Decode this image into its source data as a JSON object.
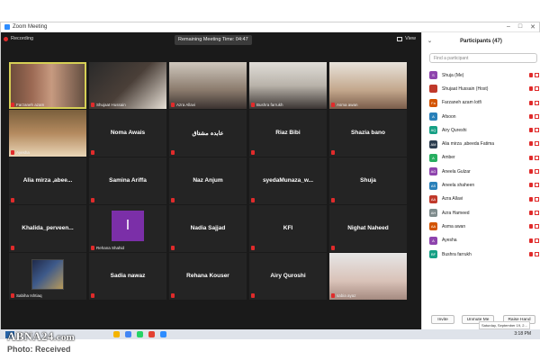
{
  "window": {
    "title": "Zoom Meeting",
    "controls": [
      "–",
      "□",
      "✕"
    ]
  },
  "meeting": {
    "recording_label": "Recording",
    "timer_text": "Remaining Meeting Time: 04:47",
    "view_label": "View"
  },
  "tiles": [
    {
      "name": "Farzaneh azam",
      "show_name_center": false,
      "label": "Farzaneh azam",
      "style": "vid1",
      "active": true
    },
    {
      "name": "Shujaat Hussain",
      "show_name_center": false,
      "label": "Shujaat Hussain",
      "style": "vid2"
    },
    {
      "name": "Azra Allavi",
      "show_name_center": false,
      "label": "Azra Allavi",
      "style": "vid3"
    },
    {
      "name": "Bushra farrukh",
      "show_name_center": false,
      "label": "Bushra farrukh",
      "style": "vid4"
    },
    {
      "name": "Asma awan",
      "show_name_center": false,
      "label": "Asma awan",
      "style": "vid5"
    },
    {
      "name": "Ayesha",
      "show_name_center": false,
      "label": "Ayesha",
      "style": "vid6"
    },
    {
      "name": "Noma Awais",
      "show_name_center": true,
      "label": ""
    },
    {
      "name": "عابدہ مشتاق",
      "show_name_center": true,
      "label": ""
    },
    {
      "name": "Riaz Bibi",
      "show_name_center": true,
      "label": ""
    },
    {
      "name": "Shazia bano",
      "show_name_center": true,
      "label": ""
    },
    {
      "name": "Alia mirza ,abee...",
      "show_name_center": true,
      "label": ""
    },
    {
      "name": "Samina Ariffa",
      "show_name_center": true,
      "label": ""
    },
    {
      "name": "Naz Anjum",
      "show_name_center": true,
      "label": ""
    },
    {
      "name": "syedaMunaza_w...",
      "show_name_center": true,
      "label": ""
    },
    {
      "name": "Shuja",
      "show_name_center": true,
      "label": ""
    },
    {
      "name": "Khalida_perveen...",
      "show_name_center": true,
      "label": ""
    },
    {
      "name": "Rehana Shahid",
      "show_name_center": false,
      "label": "Rehana Shahid",
      "style": "purple",
      "initial": "I"
    },
    {
      "name": "Nadia Sajjad",
      "show_name_center": true,
      "label": ""
    },
    {
      "name": "KFI",
      "show_name_center": true,
      "label": ""
    },
    {
      "name": "Nighat Naheed",
      "show_name_center": true,
      "label": ""
    },
    {
      "name": "Sabiha Ishtiaq",
      "show_name_center": false,
      "label": "Sabiha Ishtiaq",
      "style": "thumb"
    },
    {
      "name": "Sadia nawaz",
      "show_name_center": true,
      "label": ""
    },
    {
      "name": "Rehana Kouser",
      "show_name_center": true,
      "label": ""
    },
    {
      "name": "Airy Quroshi",
      "show_name_center": true,
      "label": ""
    },
    {
      "name": "sabia ayaz",
      "show_name_center": false,
      "label": "sabia ayaz",
      "style": "vid7"
    }
  ],
  "participants_panel": {
    "title": "Participants (47)",
    "search_placeholder": "Find a participant",
    "list": [
      {
        "initials": "S",
        "name": "Shuja (Me)",
        "color": "#8e44ad"
      },
      {
        "initials": "",
        "name": "Shujaat Hussain (Host)",
        "color": "#c0392b"
      },
      {
        "initials": "Fa",
        "name": "Farzaneh azam lotfi",
        "color": "#d35400"
      },
      {
        "initials": "A",
        "name": "Afsoon",
        "color": "#2980b9"
      },
      {
        "initials": "AQ",
        "name": "Airy Qureshi",
        "color": "#16a085"
      },
      {
        "initials": "AM",
        "name": "Alia mirza ,abeeda Fatima",
        "color": "#2c3e50"
      },
      {
        "initials": "A",
        "name": "Amber",
        "color": "#27ae60"
      },
      {
        "initials": "AG",
        "name": "Aneela Gulzar",
        "color": "#8e44ad"
      },
      {
        "initials": "AS",
        "name": "Aneela shaheen",
        "color": "#2980b9"
      },
      {
        "initials": "AA",
        "name": "Azra Allavi",
        "color": "#c0392b"
      },
      {
        "initials": "AH",
        "name": "Azra Hameed",
        "color": "#7f8c8d"
      },
      {
        "initials": "AA",
        "name": "Asma awan",
        "color": "#d35400"
      },
      {
        "initials": "A",
        "name": "Ayesha",
        "color": "#8e44ad"
      },
      {
        "initials": "BF",
        "name": "Bushra farrukh",
        "color": "#16a085"
      }
    ],
    "buttons": {
      "invite": "Invite",
      "unmute": "Unmute Me",
      "raise_hand": "Raise Hand"
    },
    "tooltip": "Saturday, September 19, 2..."
  },
  "taskbar": {
    "time": "3:18 PM"
  },
  "watermark": {
    "logo_main": "ABNA24",
    "logo_tld": ".com",
    "photo_credit": "Photo: Received"
  }
}
